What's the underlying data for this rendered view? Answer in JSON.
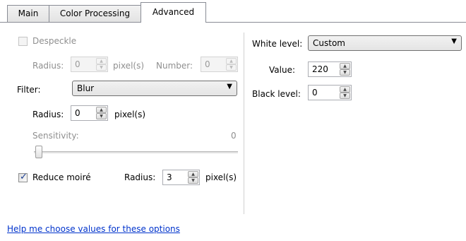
{
  "tabs": [
    {
      "label": "Main"
    },
    {
      "label": "Color Processing"
    },
    {
      "label": "Advanced"
    }
  ],
  "despeckle": {
    "label": "Despeckle",
    "checked": false,
    "radius_label": "Radius:",
    "radius_value": "0",
    "unit": "pixel(s)",
    "number_label": "Number:",
    "number_value": "0"
  },
  "filter": {
    "label": "Filter:",
    "selected": "Blur",
    "radius_label": "Radius:",
    "radius_value": "0",
    "unit": "pixel(s)",
    "sensitivity_label": "Sensitivity:",
    "sensitivity_value": "0"
  },
  "reduce_moire": {
    "label": "Reduce moiré",
    "checked": true,
    "radius_label": "Radius:",
    "radius_value": "3",
    "unit": "pixel(s)"
  },
  "white_level": {
    "label": "White level:",
    "selected": "Custom",
    "value_label": "Value:",
    "value": "220"
  },
  "black_level": {
    "label": "Black level:",
    "value": "0"
  },
  "help_link": "Help me choose values for these options",
  "icons": {
    "spin_up": "spinner-up-icon",
    "spin_down": "spinner-down-icon",
    "dropdown": "dropdown-arrow-icon",
    "check": "checkmark-icon"
  }
}
